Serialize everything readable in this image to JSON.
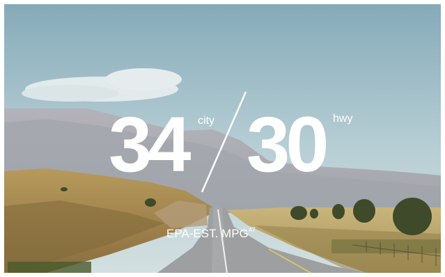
{
  "mpg": {
    "city_value": "34",
    "city_label": "city",
    "hwy_value": "30",
    "hwy_label": "hwy",
    "caption": "EPA-EST. MPG",
    "footnote": "47"
  },
  "colors": {
    "text": "#ffffff",
    "sky_top": "#8fb3c0",
    "sky_bottom": "#c7d8dc",
    "mountain": "#a7a9b1",
    "field": "#a58a50",
    "road": "#9a9c9d"
  }
}
